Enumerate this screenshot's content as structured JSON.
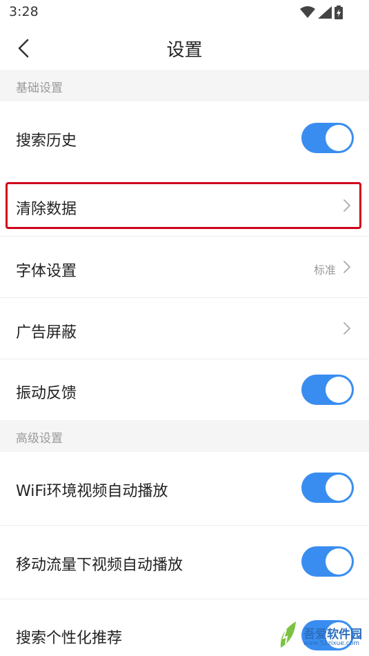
{
  "status_bar": {
    "time": "3:28"
  },
  "header": {
    "title": "设置"
  },
  "sections": {
    "basic": {
      "title": "基础设置",
      "search_history": {
        "label": "搜索历史",
        "on": true
      },
      "clear_data": {
        "label": "清除数据"
      },
      "font_settings": {
        "label": "字体设置",
        "value": "标准"
      },
      "ad_block": {
        "label": "广告屏蔽"
      },
      "vibration": {
        "label": "振动反馈",
        "on": true
      }
    },
    "advanced": {
      "title": "高级设置",
      "wifi_autoplay": {
        "label": "WiFi环境视频自动播放",
        "on": true
      },
      "mobile_autoplay": {
        "label": "移动流量下视频自动播放",
        "on": true
      },
      "personalized": {
        "label": "搜索个性化推荐",
        "on": true
      }
    }
  },
  "watermark": {
    "text": "吾爱软件园",
    "url": "www.52zixue.com"
  },
  "colors": {
    "accent": "#3a8df0",
    "highlight": "#d0021b",
    "section_bg": "#f5f5f5"
  }
}
